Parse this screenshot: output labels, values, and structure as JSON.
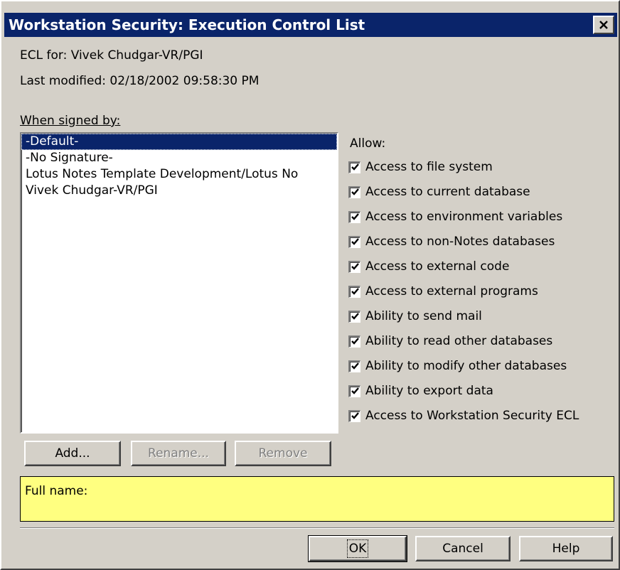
{
  "window": {
    "title": "Workstation Security:  Execution Control List"
  },
  "info": {
    "ecl_for": "ECL for:  Vivek Chudgar-VR/PGI",
    "last_modified": "Last modified:  02/18/2002 09:58:30 PM"
  },
  "signers": {
    "label": "When signed by:",
    "items": [
      {
        "label": "-Default-",
        "selected": true
      },
      {
        "label": "-No Signature-",
        "selected": false
      },
      {
        "label": "Lotus Notes Template Development/Lotus No",
        "selected": false
      },
      {
        "label": "Vivek Chudgar-VR/PGI",
        "selected": false
      }
    ]
  },
  "allow": {
    "label": "Allow:",
    "items": [
      {
        "label": "Access to file system",
        "checked": true
      },
      {
        "label": "Access to current database",
        "checked": true
      },
      {
        "label": "Access to environment variables",
        "checked": true
      },
      {
        "label": "Access to non-Notes databases",
        "checked": true
      },
      {
        "label": "Access to external code",
        "checked": true
      },
      {
        "label": "Access to external programs",
        "checked": true
      },
      {
        "label": "Ability to send mail",
        "checked": true
      },
      {
        "label": "Ability to read other databases",
        "checked": true
      },
      {
        "label": "Ability to modify other databases",
        "checked": true
      },
      {
        "label": "Ability to export data",
        "checked": true
      },
      {
        "label": "Access to Workstation Security ECL",
        "checked": true
      }
    ]
  },
  "buttons": {
    "add": "Add...",
    "rename": "Rename...",
    "remove": "Remove",
    "ok": "OK",
    "cancel": "Cancel",
    "help": "Help"
  },
  "fullname": {
    "label": "Full name:"
  },
  "icons": {
    "close": "close-icon",
    "check": "check-icon"
  },
  "colors": {
    "titlebar": "#0a246a",
    "face": "#d4d0c8",
    "fullname_bg": "#ffff80",
    "selection": "#0a246a"
  }
}
